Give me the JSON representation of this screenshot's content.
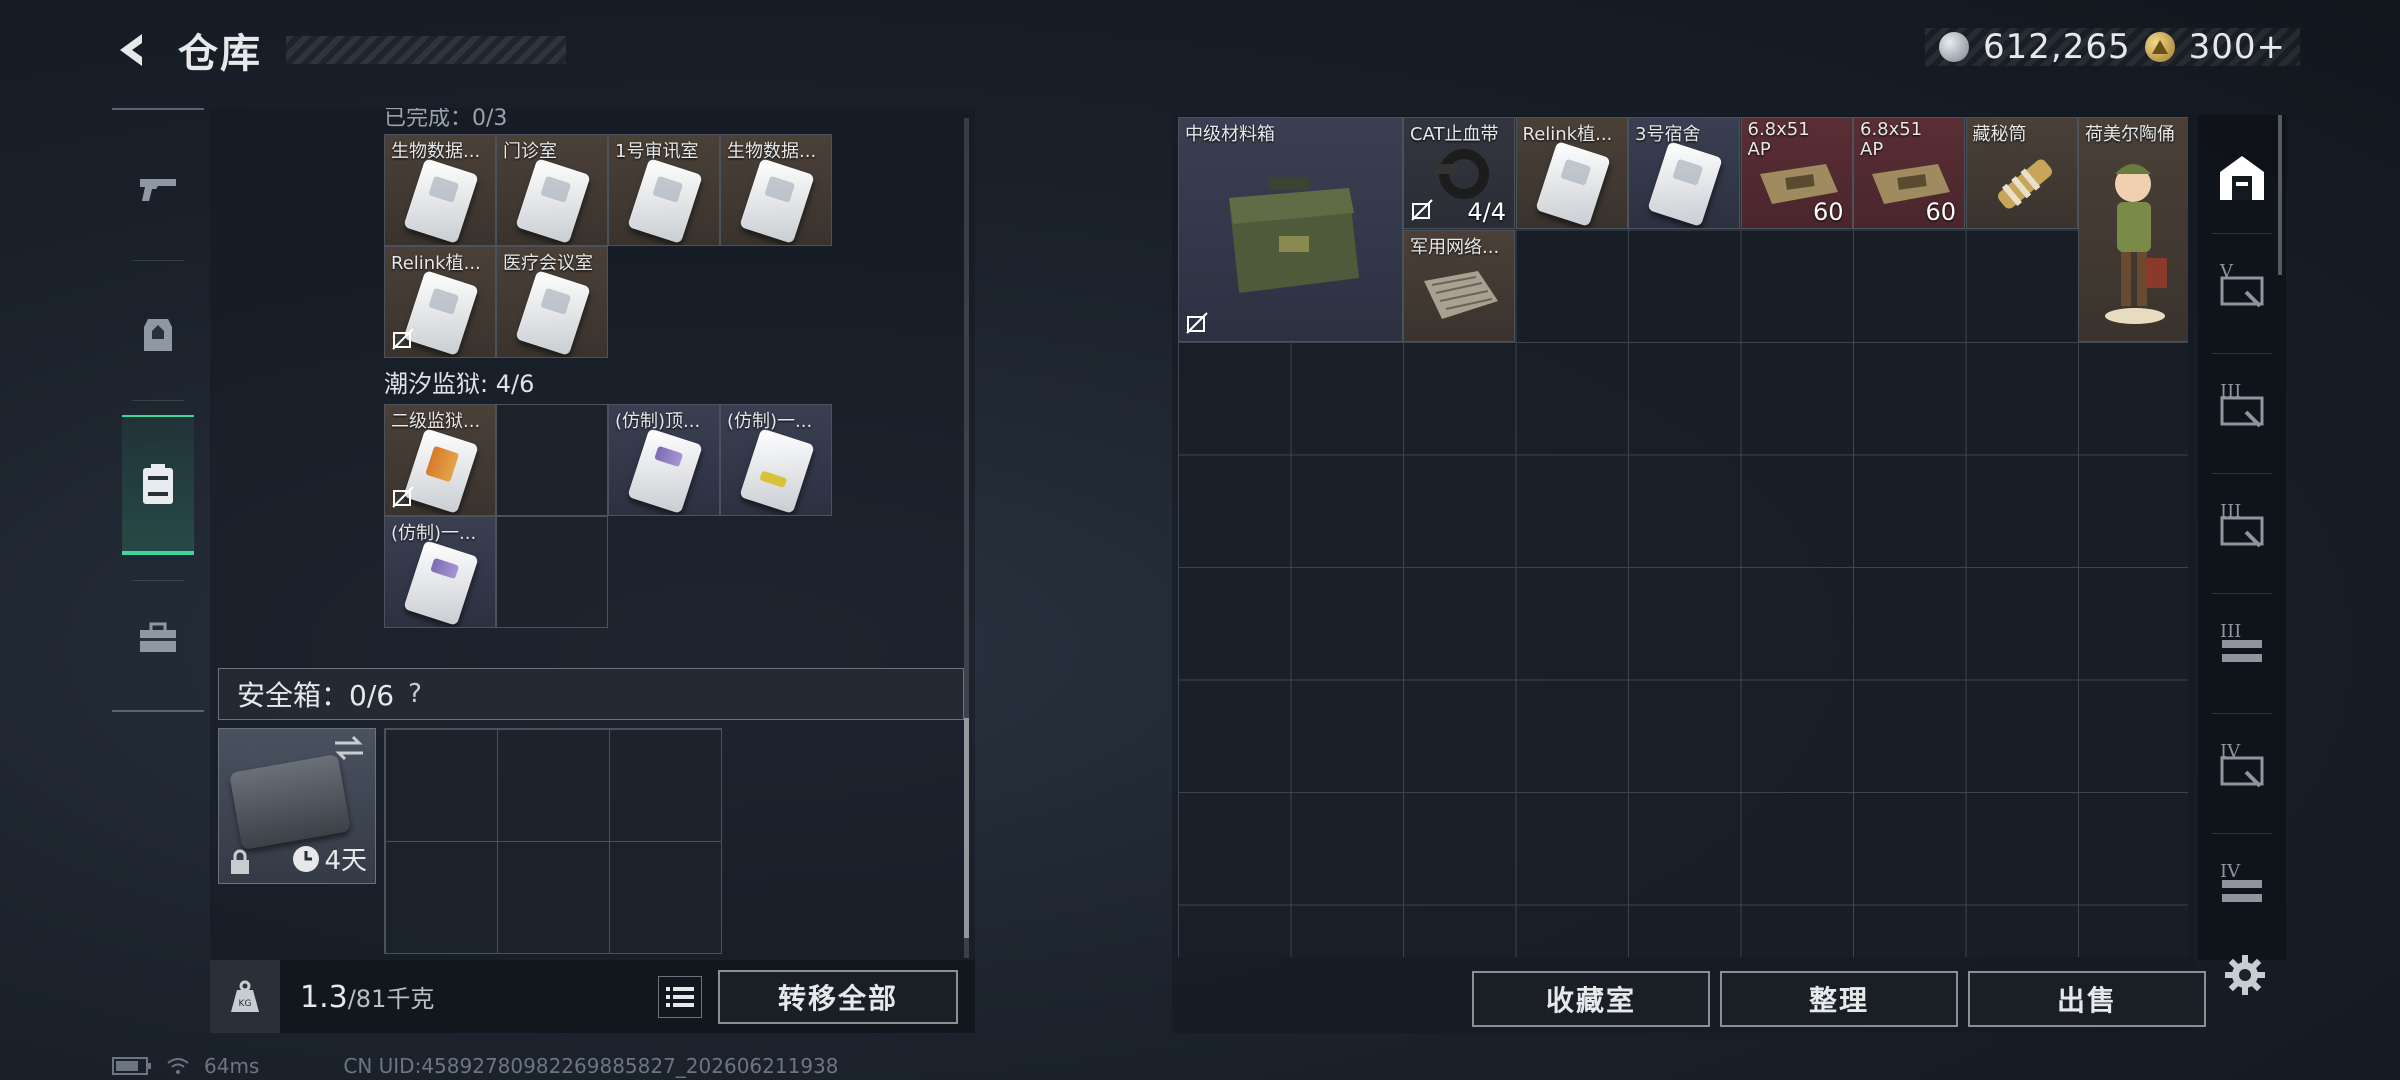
{
  "header": {
    "title": "仓库"
  },
  "currency": {
    "silver": "612,265",
    "gold": "300+"
  },
  "left_panel": {
    "cut_label": "已完成：0/3",
    "prison_label": "潮汐监狱: 4/6",
    "cards_top": [
      {
        "label": "生物数据...",
        "style": "brown",
        "locked": false
      },
      {
        "label": "门诊室",
        "style": "brown",
        "locked": false
      },
      {
        "label": "1号审讯室",
        "style": "brown",
        "locked": false
      },
      {
        "label": "生物数据...",
        "style": "brown",
        "locked": false
      },
      {
        "label": "Relink植...",
        "style": "brown",
        "locked": true
      },
      {
        "label": "医疗会议室",
        "style": "brown",
        "locked": false
      }
    ],
    "cards_prison": [
      {
        "label": "二级监狱...",
        "style": "brown",
        "locked": true
      },
      {
        "label": "(仿制)顶...",
        "style": "navy",
        "locked": false
      },
      {
        "label": "(仿制)一...",
        "style": "navy",
        "locked": false
      },
      {
        "label": "(仿制)一...",
        "style": "navy",
        "locked": false
      }
    ],
    "safe_box": {
      "label": "安全箱：0/6",
      "help": "?",
      "timer": "4天"
    },
    "weight": {
      "current": "1.3",
      "capacity": "/81千克"
    },
    "transfer_all": "转移全部"
  },
  "stash": {
    "items": [
      {
        "label": "中级材料箱",
        "style": "navy",
        "count": "",
        "locked": true
      },
      {
        "label": "CAT止血带",
        "style": "green",
        "count": "4/4",
        "locked": true
      },
      {
        "label": "Relink植...",
        "style": "brown",
        "count": "",
        "locked": false
      },
      {
        "label": "3号宿舍",
        "style": "navy",
        "count": "",
        "locked": false
      },
      {
        "label": "6.8x51 AP",
        "style": "red",
        "count": "60",
        "locked": false
      },
      {
        "label": "6.8x51 AP",
        "style": "red",
        "count": "60",
        "locked": false
      },
      {
        "label": "藏秘筒",
        "style": "brown",
        "count": "",
        "locked": false
      },
      {
        "label": "荷美尔陶俑",
        "style": "brown",
        "count": "",
        "locked": false
      },
      {
        "label": "军用网络...",
        "style": "brown",
        "count": "",
        "locked": false
      }
    ],
    "buttons": {
      "collection": "收藏室",
      "sort": "整理",
      "sell": "出售"
    }
  },
  "rail": {
    "tiers": [
      "V",
      "III",
      "III",
      "III",
      "IV",
      "IV"
    ]
  },
  "status": {
    "ping": "64ms",
    "uid": "CN UID:4589278098226988582​7_202606211938"
  },
  "colors": {
    "accent": "#3fd69a",
    "brown_slot": "#4a4038",
    "navy_slot": "#3a3f52",
    "red_slot": "#5a2e35"
  }
}
